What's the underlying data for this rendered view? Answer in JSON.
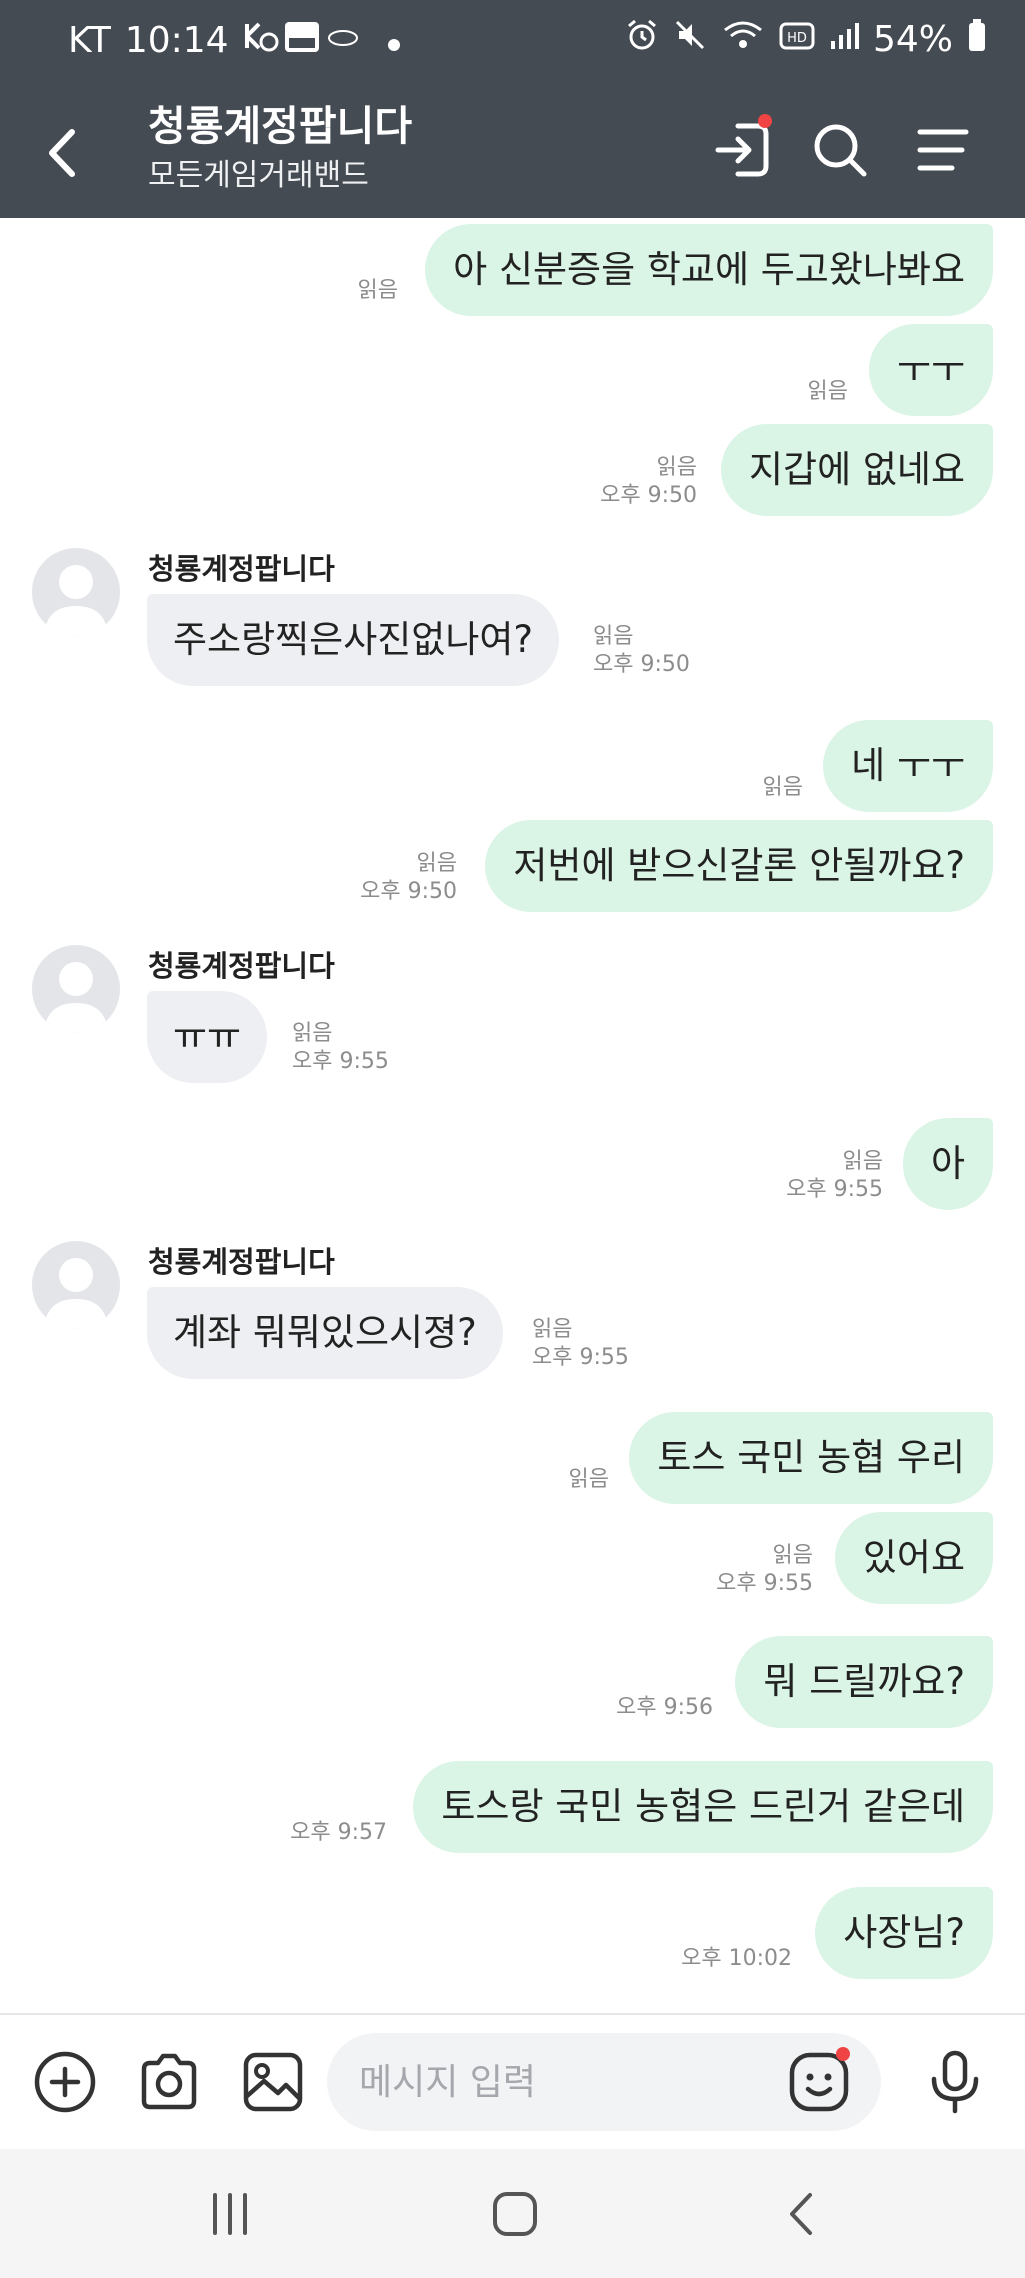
{
  "status_bar": {
    "carrier": "KT",
    "time": "10:14",
    "battery": "54%"
  },
  "header": {
    "title": "청룡계정팝니다",
    "subtitle": "모든게임거래밴드"
  },
  "messages": [
    {
      "from": "me",
      "text": "아 신분증을 학교에 두고왔나봐요",
      "read": "읽음",
      "time": ""
    },
    {
      "from": "me",
      "text": "ㅜㅜ",
      "read": "읽음",
      "time": ""
    },
    {
      "from": "me",
      "text": "지갑에 없네요",
      "read": "읽음",
      "time": "오후 9:50"
    },
    {
      "from": "other",
      "sender": "청룡계정팝니다",
      "text": "주소랑찍은사진없나여?",
      "read": "읽음",
      "time": "오후 9:50"
    },
    {
      "from": "me",
      "text": "네 ㅜㅜ",
      "read": "읽음",
      "time": ""
    },
    {
      "from": "me",
      "text": "저번에 받으신갈론 안될까요?",
      "read": "읽음",
      "time": "오후 9:50"
    },
    {
      "from": "other",
      "sender": "청룡계정팝니다",
      "text": "ㅠㅠ",
      "read": "읽음",
      "time": "오후 9:55"
    },
    {
      "from": "me",
      "text": "아",
      "read": "읽음",
      "time": "오후 9:55"
    },
    {
      "from": "other",
      "sender": "청룡계정팝니다",
      "text": "계좌 뭐뭐있으시졍?",
      "read": "읽음",
      "time": "오후 9:55"
    },
    {
      "from": "me",
      "text": "토스 국민 농협 우리",
      "read": "읽음",
      "time": ""
    },
    {
      "from": "me",
      "text": "있어요",
      "read": "읽음",
      "time": "오후 9:55"
    },
    {
      "from": "me",
      "text": "뭐 드릴까요?",
      "read": "",
      "time": "오후 9:56"
    },
    {
      "from": "me",
      "text": "토스랑 국민 농협은 드린거 같은데",
      "read": "",
      "time": "오후 9:57"
    },
    {
      "from": "me",
      "text": "사장님?",
      "read": "",
      "time": "오후 10:02"
    }
  ],
  "input": {
    "placeholder": "메시지 입력"
  },
  "colors": {
    "header_bg": "#454b52",
    "my_bubble": "#daf4e5",
    "other_bubble": "#eeeff2",
    "notification_dot": "#f04444"
  },
  "icons": {
    "header": [
      "back-arrow-icon",
      "exit-icon",
      "search-icon",
      "menu-icon"
    ],
    "input_bar": [
      "plus-circle-icon",
      "camera-icon",
      "image-icon",
      "emoji-icon",
      "microphone-icon"
    ],
    "nav_bar": [
      "recent-apps-icon",
      "home-icon",
      "back-icon"
    ]
  }
}
